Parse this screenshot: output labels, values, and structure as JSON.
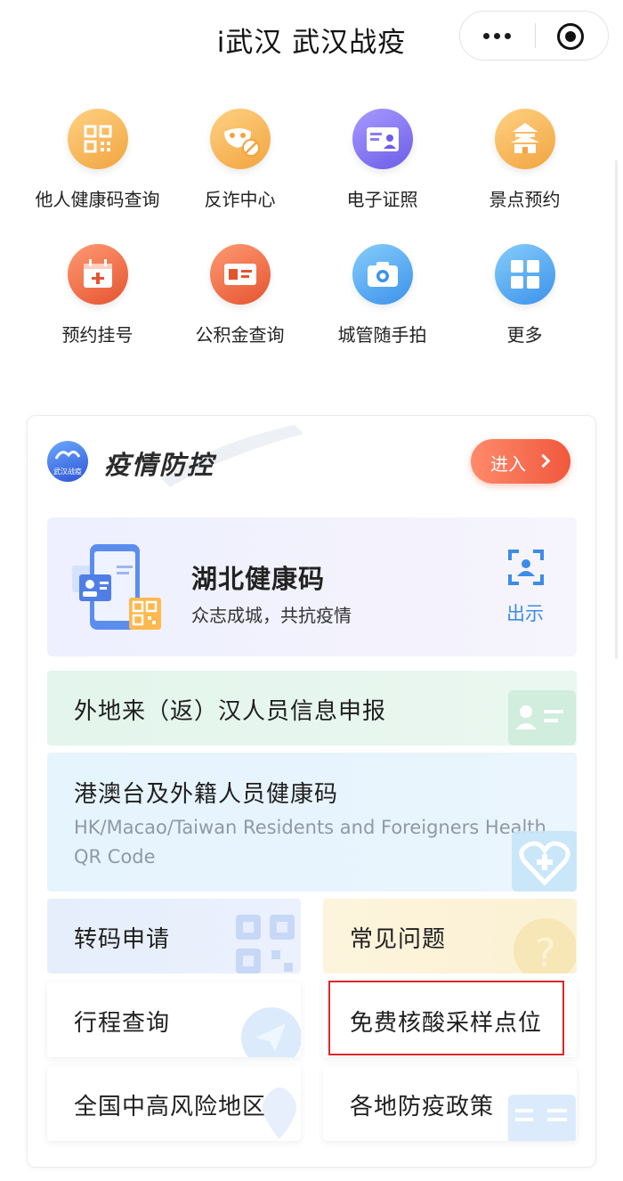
{
  "header": {
    "title": "i武汉 武汉战疫"
  },
  "grid": [
    {
      "label": "他人健康码查询",
      "icon": "qrcode-icon"
    },
    {
      "label": "反诈中心",
      "icon": "mask-block-icon"
    },
    {
      "label": "电子证照",
      "icon": "id-card-icon"
    },
    {
      "label": "景点预约",
      "icon": "pavilion-icon"
    },
    {
      "label": "预约挂号",
      "icon": "calendar-plus-icon"
    },
    {
      "label": "公积金查询",
      "icon": "card-icon"
    },
    {
      "label": "城管随手拍",
      "icon": "camera-icon"
    },
    {
      "label": "更多",
      "icon": "grid-icon"
    }
  ],
  "card": {
    "title": "疫情防控",
    "logo_text": "武汉战疫",
    "enter_label": "进入",
    "health": {
      "title": "湖北健康码",
      "subtitle": "众志成城，共抗疫情",
      "action_label": "出示"
    },
    "report_label": "外地来（返）汉人员信息申报",
    "hk": {
      "title": "港澳台及外籍人员健康码",
      "subtitle": "HK/Macao/Taiwan Residents and Foreigners Health QR Code"
    },
    "items": {
      "zhuanma": "转码申请",
      "faq": "常见问题",
      "trip": "行程查询",
      "nat_sites": "免费核酸采样点位",
      "risk_areas": "全国中高风险地区",
      "policy": "各地防疫政策"
    }
  },
  "colors": {
    "accent_orange": "#f0583d",
    "link_blue": "#3d8ce8",
    "highlight_red": "#e0262a"
  }
}
